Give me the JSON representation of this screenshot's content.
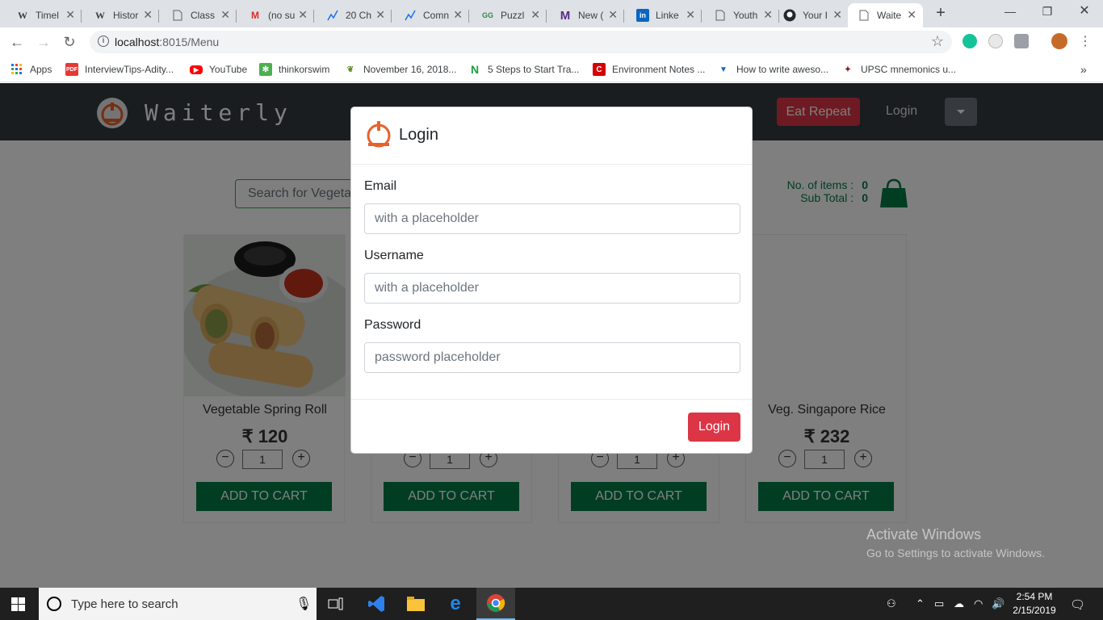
{
  "browser": {
    "tabs": [
      {
        "title": "Timel",
        "icon": "wikipedia-icon"
      },
      {
        "title": "Histor",
        "icon": "wikipedia-icon"
      },
      {
        "title": "Class",
        "icon": "document-icon"
      },
      {
        "title": "(no su",
        "icon": "gmail-icon"
      },
      {
        "title": "20 Ch",
        "icon": "chart-icon"
      },
      {
        "title": "Comn",
        "icon": "chart-icon"
      },
      {
        "title": "Puzzl",
        "icon": "gfg-icon"
      },
      {
        "title": "New (",
        "icon": "medium-icon"
      },
      {
        "title": "Linke",
        "icon": "linkedin-icon"
      },
      {
        "title": "Youth",
        "icon": "document-icon"
      },
      {
        "title": "Your I",
        "icon": "github-icon"
      },
      {
        "title": "Waite",
        "icon": "document-icon",
        "active": true
      }
    ],
    "url_host": "localhost",
    "url_rest": ":8015/Menu",
    "bookmarks": [
      {
        "label": "Apps",
        "icon": "apps-grid-icon"
      },
      {
        "label": "InterviewTips-Adity...",
        "icon": "pdf-icon"
      },
      {
        "label": "YouTube",
        "icon": "youtube-icon"
      },
      {
        "label": "thinkorswim",
        "icon": "thinkorswim-icon"
      },
      {
        "label": "November 16, 2018...",
        "icon": "leaf-icon"
      },
      {
        "label": "5 Steps to Start Tra...",
        "icon": "n-logo-icon"
      },
      {
        "label": "Environment Notes ...",
        "icon": "c-logo-icon"
      },
      {
        "label": "How to write aweso...",
        "icon": "trophy-icon"
      },
      {
        "label": "UPSC mnemonics u...",
        "icon": "upsc-icon"
      }
    ],
    "more_bookmarks": "»"
  },
  "app": {
    "brand": "Waiterly",
    "eat_repeat": "Eat Repeat",
    "nav_login": "Login",
    "search_placeholder": "Search for Vegeta",
    "cart": {
      "items_label": "No. of items",
      "items_value": "0",
      "subtotal_label": "Sub Total",
      "subtotal_value": "0",
      "sep": ":"
    },
    "products": [
      {
        "name": "Vegetable Spring Roll",
        "price": "₹ 120",
        "qty": "1",
        "add": "ADD TO CART",
        "image": "spring-roll-image"
      },
      {
        "name": "",
        "price": "",
        "qty": "1",
        "add": "ADD TO CART"
      },
      {
        "name": "",
        "price": "",
        "qty": "1",
        "add": "ADD TO CART"
      },
      {
        "name": "Veg. Singapore Rice",
        "price": "₹ 232",
        "qty": "1",
        "add": "ADD TO CART"
      }
    ],
    "minus": "−",
    "plus": "+"
  },
  "modal": {
    "title": "Login",
    "email_label": "Email",
    "email_placeholder": "with a placeholder",
    "username_label": "Username",
    "username_placeholder": "with a placeholder",
    "password_label": "Password",
    "password_placeholder": "password placeholder",
    "submit": "Login"
  },
  "watermark": {
    "line1": "Activate Windows",
    "line2": "Go to Settings to activate Windows."
  },
  "taskbar": {
    "search_placeholder": "Type here to search",
    "time": "2:54 PM",
    "date": "2/15/2019"
  },
  "colors": {
    "navbar": "#343a40",
    "danger": "#dc3545",
    "success": "#007b45"
  }
}
